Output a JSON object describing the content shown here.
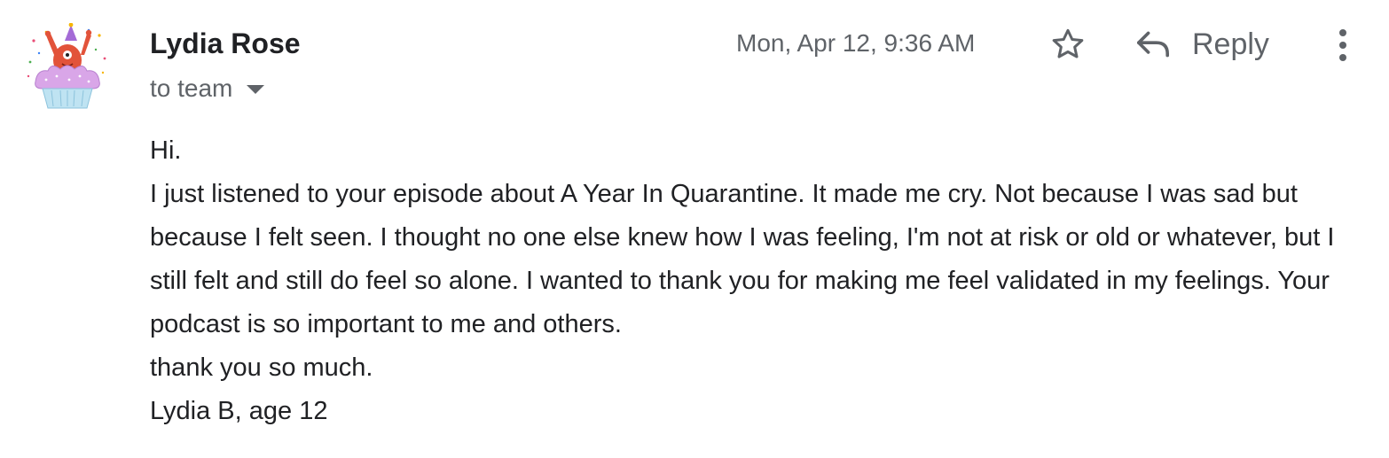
{
  "sender": {
    "name": "Lydia Rose",
    "avatar_icon": "cupcake-monster-avatar"
  },
  "recipient": {
    "label": "to team",
    "toggle_icon": "caret-down-icon"
  },
  "timestamp": "Mon, Apr 12, 9:36 AM",
  "actions": {
    "star_icon": "star-outline-icon",
    "reply_icon": "reply-arrow-icon",
    "reply_label": "Reply",
    "more_icon": "more-vert-icon"
  },
  "body": {
    "greeting": "Hi.",
    "paragraph": "I just listened to your episode about A Year In Quarantine. It made me cry. Not because I was sad but because I felt seen. I thought no one else knew how I was feeling, I'm not at risk or old or whatever, but I still felt and still do feel so alone. I wanted to thank you for making me feel validated in my feelings. Your podcast is so important to me and others.",
    "closing": "thank you so much.",
    "signature": "Lydia B, age 12"
  },
  "colors": {
    "primary_text": "#202124",
    "secondary_text": "#5f6368",
    "icon": "#5f6368",
    "avatar_creature": "#e2533a",
    "avatar_frosting": "#d9a6e8",
    "avatar_cup": "#bfe3f2"
  }
}
